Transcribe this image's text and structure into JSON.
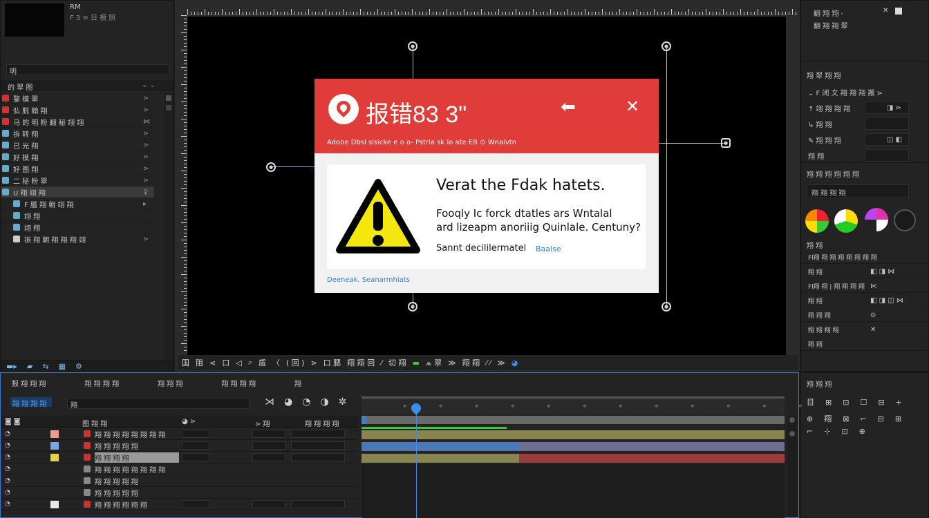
{
  "project": {
    "thumb_label": "RM",
    "thumb_sub": "F 3 ≡ 日 模 照",
    "search_value": "明",
    "header": "的 翠 图",
    "header_icon": "⌄ ⌄",
    "items": [
      {
        "label": "鏊 模 翠",
        "glyph": "⋗"
      },
      {
        "label": "弘 脱 翰 翔",
        "glyph": "⋗"
      },
      {
        "label": "马 的 明 粉 翻 秘 翊 翊",
        "glyph": "⋈"
      },
      {
        "label": "拆 转 翔",
        "glyph": "⋗"
      },
      {
        "label": "已 光 翔",
        "glyph": "⋗"
      },
      {
        "label": "好 模 翔",
        "glyph": "⋗"
      },
      {
        "label": "好 图 翔",
        "glyph": "⋗"
      },
      {
        "label": "二 秘 粉 翠",
        "glyph": "⋗"
      },
      {
        "label": "U 翔 翊 翔",
        "glyph": "♀"
      },
      {
        "label": "F 膳 翔 朝 翊 翔",
        "glyph": "▸"
      },
      {
        "label": "翊 翔",
        "glyph": ""
      },
      {
        "label": "翊 翔",
        "glyph": ""
      },
      {
        "label": "振 翔 朝 翔 翔 翔 翊",
        "glyph": "⋗"
      }
    ],
    "footer_icons": [
      "▬▸",
      "▰",
      "⇆",
      "▦",
      "⚙"
    ]
  },
  "viewer": {
    "toolbar": [
      "国",
      "阻",
      "⋖",
      "口",
      "◁",
      "⌕",
      "盾",
      "〈",
      "( 回 )",
      "⋗",
      "口 腮",
      "翔 翔 回",
      "⁄",
      "切 翔",
      "▬",
      "⩕ 翠",
      "≫",
      "翔 翔",
      "⁄ ⁄",
      "≫",
      "◕"
    ]
  },
  "dialog": {
    "title": "报错83 3\"",
    "arrow": "⬅",
    "close": "✕",
    "subtitle": "Adobe Dbsl slsicke e  o o- Pstrla  sk  lo  ate  EB  ⊙  Wnalvtn",
    "heading": "Verat the Fdak hatets.",
    "body1": "Fooqly Ic forck dtatles ars Wntalal",
    "body2": "ard lizeapm anoriiig Quinlale. Centuny?",
    "detail_text": "Sannt decililermatel",
    "detail_link": "Baalse",
    "footer_link": "Deeneak. Seanarmhiats"
  },
  "right": {
    "top1": "翻 翔 翔 ⋅",
    "top2": "翻 翔 翔 翠",
    "top_x": "✕",
    "effects_title": "翔 翠 翔 翔",
    "effects": [
      {
        "label": "⌄  F 闭 文 翔 翔 翔 搬 ⋗"
      },
      {
        "label": "↑  翊 翔 翔 翔",
        "val": "◨ ⋗"
      },
      {
        "label": "↳  翔 翔",
        "val": ""
      },
      {
        "label": "✎  翔 翔 翔",
        "val": "◫ ◧"
      },
      {
        "label": "翔 翔",
        "val": ""
      }
    ],
    "color_title": "翔 翔 翔 翔 翔 翔",
    "color_field": "翔 翔 翔 翔",
    "params_title": "翔 翔",
    "params": [
      {
        "label": "Fl翔 翔 翔 翔 翔 翔 翔 翔",
        "val": ""
      },
      {
        "label": "翔 翔",
        "val": "◧ ◨  ⋈"
      },
      {
        "label": "Fl翔 翔 | 翔 翔 翔 翔",
        "val": "⋉"
      },
      {
        "label": "翔 翔",
        "val": "◧ ◨  ◫  ⋈"
      },
      {
        "label": "翔 翔 翔",
        "val": "⊙"
      },
      {
        "label": "翔 翔 翔 翔",
        "val": "✕"
      },
      {
        "label": "翔 翔",
        "val": ""
      }
    ],
    "bottom_title": "翔 翔 翔",
    "bottom_icons_1": [
      "目",
      "⊞",
      "⊡",
      "☐",
      "⊟",
      "+"
    ],
    "bottom_icons_2": [
      "⊕",
      "翔",
      "⊠",
      "⌐",
      "⊟",
      "⊞"
    ],
    "bottom_icons_3": [
      "⌐",
      "⊹",
      "⊡",
      "⊕"
    ]
  },
  "timeline": {
    "tabs": [
      "报 翔 翔 翔",
      "翔 翔 翔 翔",
      "翔 翔 翔",
      "翔 翔 翔 翔",
      "翔"
    ],
    "comp_label": "翔 翔 翔 翔",
    "search_value": "翔",
    "tools": [
      "⋊",
      "◕",
      "◔",
      "◑",
      "✲"
    ],
    "col_head": [
      "◙ ◙",
      "图 翔 翔",
      "◕ ⋗",
      "⋗ 翔",
      "翔 翔 翔 翔"
    ],
    "layers": [
      {
        "name": "翔 翔 翔 翔 翔 翔 翔 翔",
        "color": "#f09a8a"
      },
      {
        "name": "翔 翔 翔 翔 翔",
        "color": "#7aa7e0"
      },
      {
        "name": "翔 翔 翔 翔",
        "color": "#e8d24a"
      },
      {
        "name": "翔 翔 翔 翔 翔 翔 翔 翔",
        "color": ""
      },
      {
        "name": "翔 翔 翔 翔 翔",
        "color": ""
      },
      {
        "name": "翔 翔 翔 翔 翔",
        "color": ""
      },
      {
        "name": "翔 翔 翔 翔 翔 翔",
        "color": "#e8e8e8"
      }
    ],
    "ruler_marks": [
      "⌖",
      "⌖",
      "⌖",
      "⌖",
      "⌖",
      "⌖",
      "⌖",
      "⌖",
      "⌖",
      "⌖",
      "⌖",
      "⌖"
    ]
  },
  "colors": {
    "accent": "#2f7fd4",
    "dialog_red": "#e03c3a",
    "bar_yellow": "#8a8450",
    "bar_blue": "#4d78b8",
    "bar_red": "#9b3c3c",
    "bar_gray": "#6e6e6e",
    "bar_green": "#3bcb3b"
  }
}
